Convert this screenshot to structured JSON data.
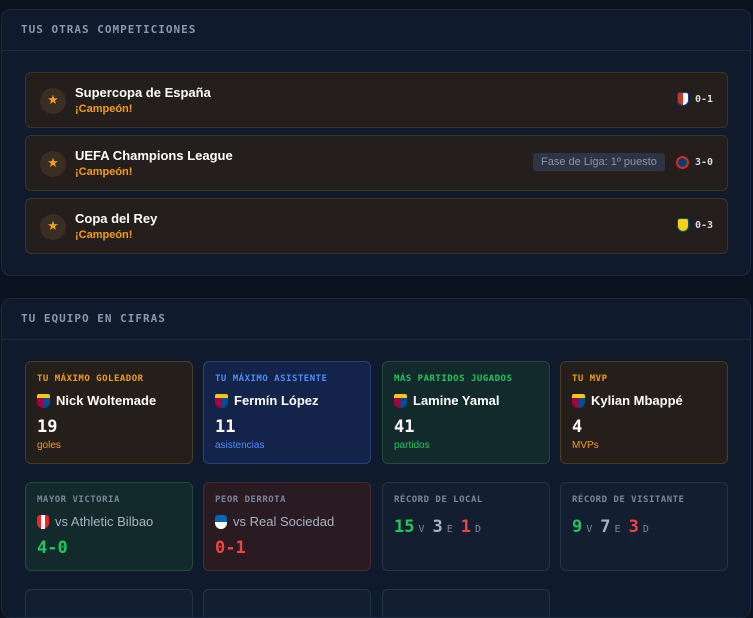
{
  "competitions": {
    "title": "TUS OTRAS COMPETICIONES",
    "items": [
      {
        "name": "Supercopa de España",
        "result": "¡Campeón!",
        "phase": "",
        "score": "0-1",
        "crest_icon": "atletico-madrid-crest-icon",
        "crest_color": "#cb3524"
      },
      {
        "name": "UEFA Champions League",
        "result": "¡Campeón!",
        "phase": "Fase de Liga: 1º puesto",
        "score": "3-0",
        "crest_icon": "psg-crest-icon",
        "crest_color": "#004170"
      },
      {
        "name": "Copa del Rey",
        "result": "¡Campeón!",
        "phase": "",
        "score": "0-3",
        "crest_icon": "villarreal-crest-icon",
        "crest_color": "#f5d10a"
      }
    ]
  },
  "stats": {
    "title": "TU EQUIPO EN CIFRAS",
    "top_scorer": {
      "label": "TU MÁXIMO GOLEADOR",
      "player": "Nick Woltemade",
      "value": "19",
      "unit": "goles"
    },
    "top_assist": {
      "label": "TU MÁXIMO ASISTENTE",
      "player": "Fermín López",
      "value": "11",
      "unit": "asistencias"
    },
    "most_played": {
      "label": "MÁS PARTIDOS JUGADOS",
      "player": "Lamine Yamal",
      "value": "41",
      "unit": "partidos"
    },
    "mvp": {
      "label": "TU MVP",
      "player": "Kylian Mbappé",
      "value": "4",
      "unit": "MVPs"
    },
    "biggest_win": {
      "label": "MAYOR VICTORIA",
      "opponent": "vs Athletic Bilbao",
      "score": "4-0"
    },
    "worst_loss": {
      "label": "PEOR DERROTA",
      "opponent": "vs Real Sociedad",
      "score": "0-1"
    },
    "home_record": {
      "label": "RÉCORD DE LOCAL",
      "w": "15",
      "w_label": "V",
      "d": "3",
      "d_label": "E",
      "l": "1",
      "l_label": "D"
    },
    "away_record": {
      "label": "RÉCORD DE VISITANTE",
      "w": "9",
      "w_label": "V",
      "d": "7",
      "d_label": "E",
      "l": "3",
      "l_label": "D"
    }
  },
  "colors": {
    "orange": "#f59e0b",
    "blue": "#4f8df5",
    "green": "#22c55e",
    "red": "#ef4444",
    "gray": "#7a869a"
  }
}
